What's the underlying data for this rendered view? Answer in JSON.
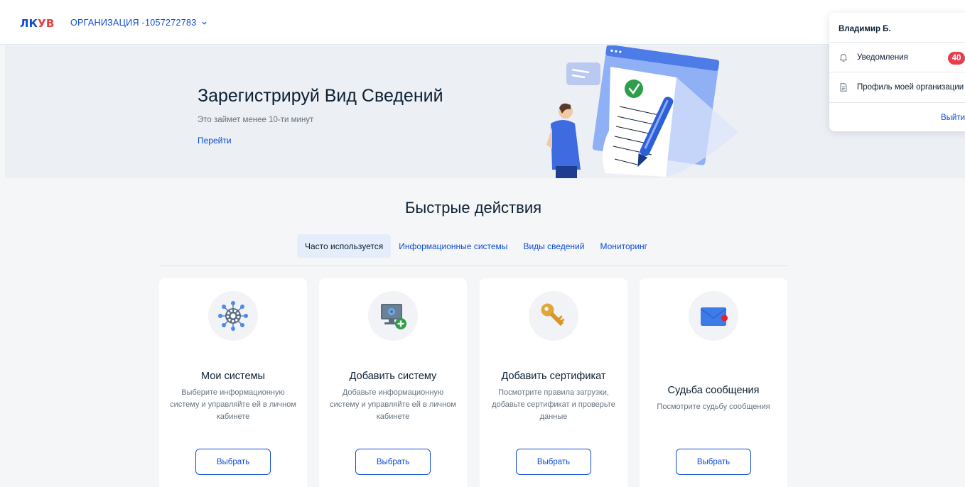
{
  "header": {
    "logo_left": "ЛК",
    "logo_right": "УВ",
    "organization": "ОРГАНИЗАЦИЯ -1057272783"
  },
  "banner": {
    "title": "Зарегистрируй Вид Сведений",
    "subtitle": "Это займет менее 10-ти минут",
    "link": "Перейти"
  },
  "user_menu": {
    "user_name": "Владимир Б.",
    "notifications_label": "Уведомления",
    "notifications_count": "40",
    "profile_label": "Профиль моей организации",
    "logout_label": "Выйти"
  },
  "quick_actions": {
    "title": "Быстрые действия",
    "tabs": [
      {
        "label": "Часто используется",
        "active": true
      },
      {
        "label": "Информационные системы",
        "active": false
      },
      {
        "label": "Виды сведений",
        "active": false
      },
      {
        "label": "Мониторинг",
        "active": false
      }
    ],
    "cards": [
      {
        "title": "Мои системы",
        "description": "Выберите информационную систему и управляйте ей в личном кабинете",
        "button": "Выбрать",
        "icon": "network-gear-icon"
      },
      {
        "title": "Добавить систему",
        "description": "Добавьте информационную систему и управляйте ей в личном кабинете",
        "button": "Выбрать",
        "icon": "computer-add-icon"
      },
      {
        "title": "Добавить сертификат",
        "description": "Посмотрите правила загрузки, добавьте сертификат и проверьте данные",
        "button": "Выбрать",
        "icon": "key-icon"
      },
      {
        "title": "Судьба сообщения",
        "description": "Посмотрите судьбу сообщения",
        "button": "Выбрать",
        "icon": "envelope-icon"
      }
    ]
  },
  "colors": {
    "accent": "#0d4cd3",
    "logo_red": "#e93c3c",
    "badge": "#e93c4c",
    "text": "#0b1f33",
    "muted": "#66727f",
    "page_bg": "#f5f6f8"
  }
}
